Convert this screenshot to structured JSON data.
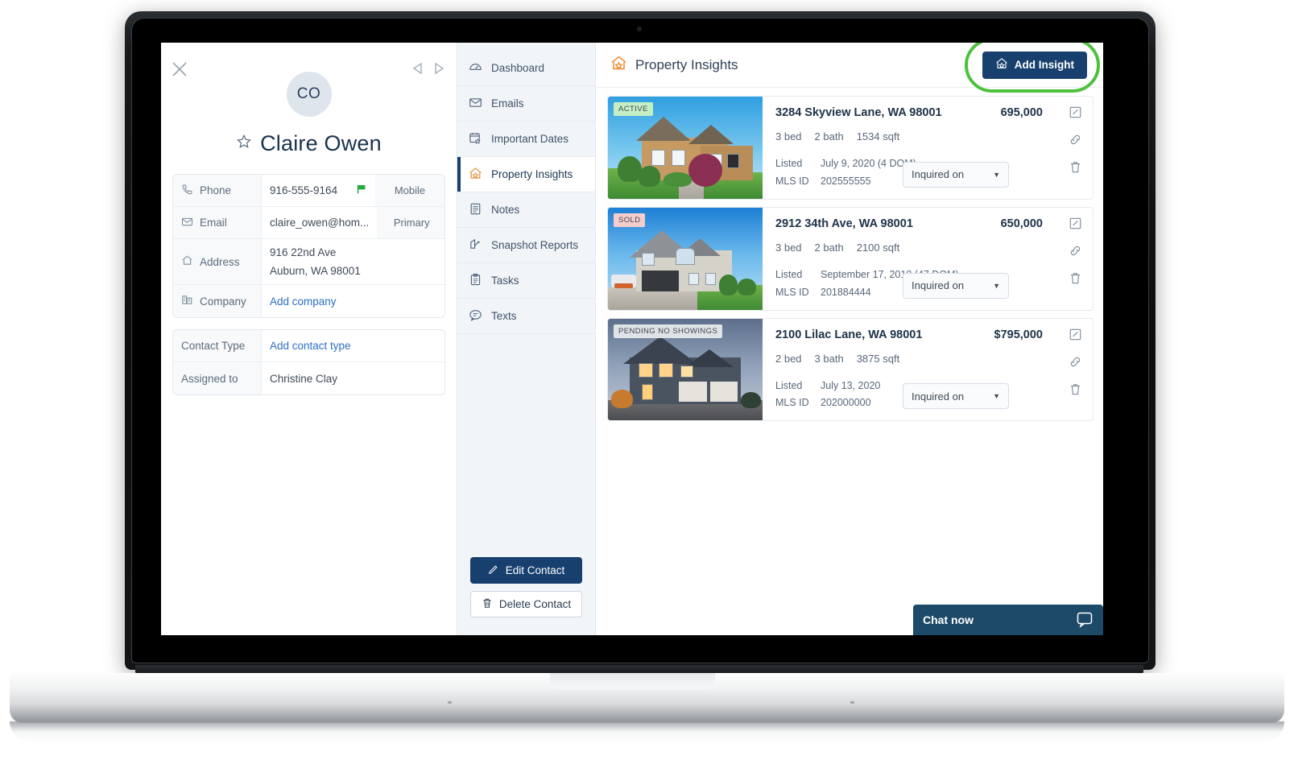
{
  "contact": {
    "avatar_initials": "CO",
    "name": "Claire Owen",
    "close_icon": "close-icon",
    "prev_icon": "prev-arrow-icon",
    "next_icon": "next-arrow-icon",
    "star_icon": "star-icon",
    "rows": [
      {
        "label": "Phone",
        "icon": "phone-icon",
        "value": "916-555-9164",
        "tag": "Mobile",
        "flag": true,
        "link": false
      },
      {
        "label": "Email",
        "icon": "envelope-icon",
        "value": "claire_owen@hom...",
        "tag": "Primary",
        "flag": false,
        "link": false
      },
      {
        "label": "Address",
        "icon": "home-icon",
        "value": "916 22nd Ave",
        "value2": "Auburn, WA 98001",
        "tag": "",
        "flag": false,
        "link": false
      },
      {
        "label": "Company",
        "icon": "building-icon",
        "value": "Add company",
        "tag": "",
        "flag": false,
        "link": true
      }
    ],
    "rows2": [
      {
        "label": "Contact Type",
        "value": "Add contact type",
        "link": true
      },
      {
        "label": "Assigned to",
        "value": "Christine Clay",
        "link": false
      }
    ]
  },
  "sidebar": {
    "items": [
      {
        "label": "Dashboard",
        "icon": "gauge-icon",
        "active": false
      },
      {
        "label": "Emails",
        "icon": "envelope-icon",
        "active": false
      },
      {
        "label": "Important Dates",
        "icon": "calendar-star-icon",
        "active": false
      },
      {
        "label": "Property Insights",
        "icon": "house-star-icon",
        "active": true
      },
      {
        "label": "Notes",
        "icon": "note-icon",
        "active": false
      },
      {
        "label": "Snapshot Reports",
        "icon": "snapshot-icon",
        "active": false
      },
      {
        "label": "Tasks",
        "icon": "clipboard-icon",
        "active": false
      },
      {
        "label": "Texts",
        "icon": "chat-icon",
        "active": false
      }
    ],
    "edit_contact_label": "Edit Contact",
    "delete_contact_label": "Delete Contact"
  },
  "main": {
    "title": "Property Insights",
    "title_icon": "house-star-icon",
    "add_insight_label": "Add Insight",
    "add_insight_icon": "house-star-icon",
    "highlight_color": "#4cc23c",
    "accent_color": "#18406f",
    "orange_color": "#ef8b2c"
  },
  "properties": [
    {
      "badge": "ACTIVE",
      "badge_style": "active",
      "address": "3284 Skyview Lane, WA 98001",
      "price": "695,000",
      "beds": "3 bed",
      "baths": "2 bath",
      "sqft": "1534 sqft",
      "listed_label": "Listed",
      "listed_value": "July 9, 2020 (4 DOM)",
      "mls_label": "MLS ID",
      "mls_value": "202555555",
      "status_select": "Inquired on",
      "edit_icon": "edit-icon",
      "link_icon": "link-icon",
      "delete_icon": "trash-icon"
    },
    {
      "badge": "SOLD",
      "badge_style": "sold",
      "address": "2912 34th Ave, WA 98001",
      "price": "650,000",
      "beds": "3 bed",
      "baths": "2 bath",
      "sqft": "2100 sqft",
      "listed_label": "Listed",
      "listed_value": "September 17, 2018 (47 DOM)",
      "mls_label": "MLS ID",
      "mls_value": "201884444",
      "status_select": "Inquired on",
      "edit_icon": "edit-icon",
      "link_icon": "link-icon",
      "delete_icon": "trash-icon"
    },
    {
      "badge": "PENDING NO SHOWINGS",
      "badge_style": "pending",
      "address": "2100 Lilac Lane, WA 98001",
      "price": "$795,000",
      "beds": "2 bed",
      "baths": "3 bath",
      "sqft": "3875 sqft",
      "listed_label": "Listed",
      "listed_value": "July 13, 2020",
      "mls_label": "MLS ID",
      "mls_value": "202000000",
      "status_select": "Inquired on",
      "edit_icon": "edit-icon",
      "link_icon": "link-icon",
      "delete_icon": "trash-icon"
    }
  ],
  "chat": {
    "label": "Chat now",
    "icon": "chat-bubble-icon"
  }
}
